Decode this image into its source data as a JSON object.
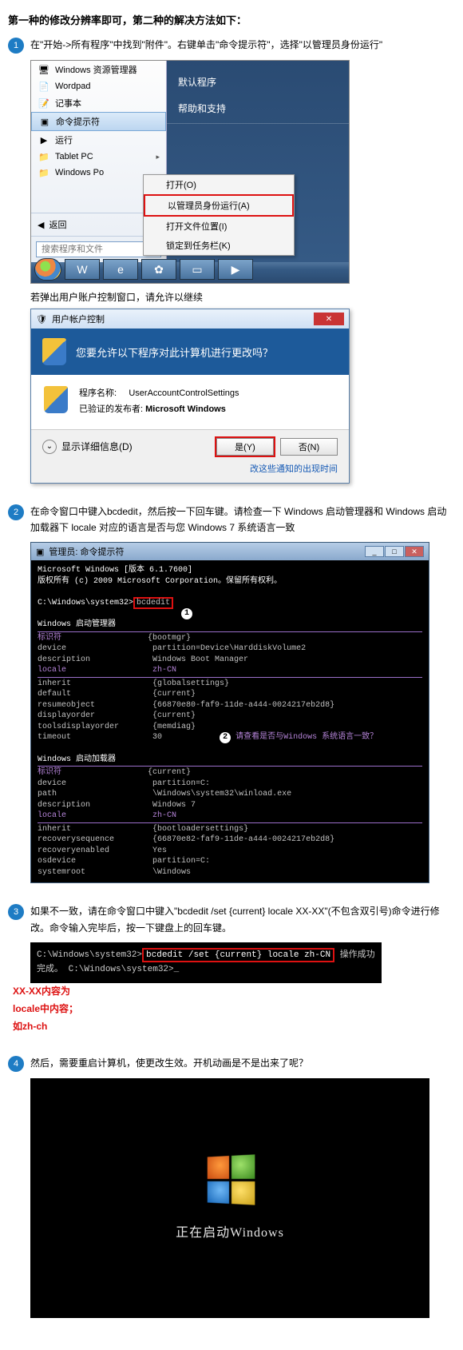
{
  "headline": "第一种的修改分辨率即可，第二种的解决方法如下：",
  "step1": {
    "num": "1",
    "text": "在\"开始->所有程序\"中找到\"附件\"。右键单击\"命令提示符\"，选择\"以管理员身份运行\"",
    "menu": {
      "i1": "Windows 资源管理器",
      "i2": "Wordpad",
      "i3": "记事本",
      "i4": "命令提示符",
      "i5": "运行",
      "i6": "Tablet PC",
      "i7": "Windows Po",
      "back": "返回",
      "search": "搜索程序和文件"
    },
    "right": {
      "r1": "默认程序",
      "r2": "帮助和支持"
    },
    "ctx": {
      "c1": "打开(O)",
      "c2": "以管理员身份运行(A)",
      "c3": "打开文件位置(I)",
      "c4": "锁定到任务栏(K)"
    },
    "afterText": "若弹出用户账户控制窗口，请允许以继续",
    "uac": {
      "title": "用户帐户控制",
      "question": "您要允许以下程序对此计算机进行更改吗？",
      "progLabel": "程序名称:",
      "progName": "UserAccountControlSettings",
      "pubLabel": "已验证的发布者:",
      "pubName": "Microsoft Windows",
      "details": "显示详细信息(D)",
      "yes": "是(Y)",
      "no": "否(N)",
      "link": "改这些通知的出现时间"
    }
  },
  "step2": {
    "num": "2",
    "text": "在命令窗口中键入bcdedit，然后按一下回车键。请检查一下 Windows 启动管理器和 Windows 启动加载器下 locale 对应的语言是否与您 Windows 7 系统语言一致",
    "title": "管理员: 命令提示符",
    "line1": "Microsoft Windows [版本 6.1.7600]",
    "line2": "版权所有 (c) 2009 Microsoft Corporation。保留所有权利。",
    "prompt": "C:\\Windows\\system32>",
    "cmd": "bcdedit",
    "badge1": "1",
    "header1": "Windows 启动管理器",
    "k1": "标识符",
    "v1": "{bootmgr}",
    "k2": "device",
    "v2": "partition=Device\\HarddiskVolume2",
    "k3": "description",
    "v3": "Windows Boot Manager",
    "k4": "locale",
    "v4": "zh-CN",
    "k5": "inherit",
    "v5": "{globalsettings}",
    "k6": "default",
    "v6": "{current}",
    "k7": "resumeobject",
    "v7": "{66870e80-faf9-11de-a444-0024217eb2d8}",
    "k8": "displayorder",
    "v8": "{current}",
    "k9": "toolsdisplayorder",
    "v9": "{memdiag}",
    "k10": "timeout",
    "v10": "30",
    "badge2": "2",
    "badge2txt": "请查看是否与Windows 系统语言一致？",
    "header2": "Windows 启动加载器",
    "l1": "标识符",
    "w1": "{current}",
    "l2": "device",
    "w2": "partition=C:",
    "l3": "path",
    "w3": "\\Windows\\system32\\winload.exe",
    "l4": "description",
    "w4": "Windows 7",
    "l5": "locale",
    "w5": "zh-CN",
    "l6": "inherit",
    "w6": "{bootloadersettings}",
    "l7": "recoverysequence",
    "w7": "{66870e82-faf9-11de-a444-0024217eb2d8}",
    "l8": "recoveryenabled",
    "w8": "Yes",
    "l9": "osdevice",
    "w9": "partition=C:",
    "l10": "systemroot",
    "w10": "\\Windows"
  },
  "step3": {
    "num": "3",
    "text": "如果不一致，请在命令窗口中键入\"bcdedit /set {current} locale XX-XX\"(不包含双引号)命令进行修改。命令输入完毕后，按一下键盘上的回车键。",
    "note1": "XX-XX内容为",
    "note2": "locale中内容；",
    "note3": "如zh-ch",
    "prompt": "C:\\Windows\\system32>",
    "cmd": "bcdedit /set {current} locale zh-CN",
    "ok": "操作成功完成。",
    "cursor": "_"
  },
  "step4": {
    "num": "4",
    "text": "然后，需要重启计算机，使更改生效。开机动画是不是出来了呢？",
    "boot": "正在启动Windows"
  }
}
